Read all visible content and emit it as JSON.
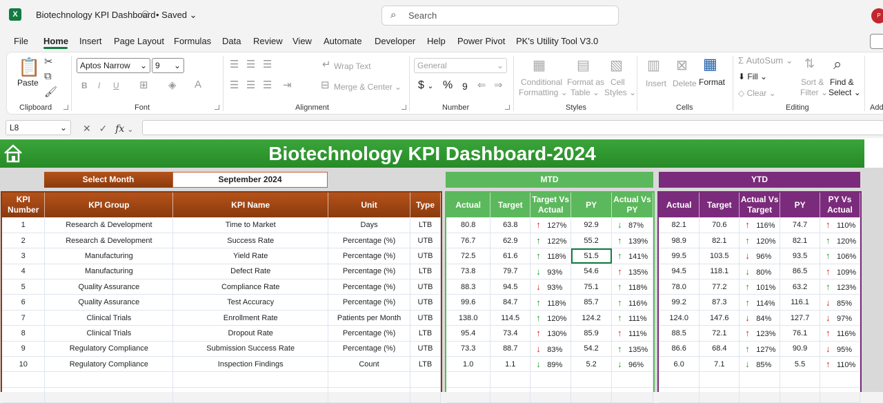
{
  "window": {
    "title": "Biotechnology KPI Dashboard",
    "saved": "• Saved",
    "search_placeholder": "Search",
    "avatar": "P"
  },
  "menu": [
    "File",
    "Home",
    "Insert",
    "Page Layout",
    "Formulas",
    "Data",
    "Review",
    "View",
    "Automate",
    "Developer",
    "Help",
    "Power Pivot",
    "PK's Utility Tool V3.0"
  ],
  "ribbon": {
    "clipboard": {
      "label": "Clipboard",
      "paste": "Paste"
    },
    "font": {
      "label": "Font",
      "name": "Aptos Narrow",
      "size": "9",
      "bold": "B",
      "italic": "I",
      "underline": "U"
    },
    "alignment": {
      "label": "Alignment",
      "wrap": "Wrap Text",
      "merge": "Merge & Center"
    },
    "number": {
      "label": "Number",
      "format": "General",
      "dollar": "$",
      "percent": "%",
      "comma": "9"
    },
    "styles": {
      "label": "Styles",
      "conditional": "Conditional",
      "conditional2": "Formatting",
      "format_table": "Format as",
      "format_table2": "Table",
      "cell_styles": "Cell",
      "cell_styles2": "Styles"
    },
    "cells": {
      "label": "Cells",
      "insert": "Insert",
      "delete": "Delete",
      "format": "Format"
    },
    "editing": {
      "label": "Editing",
      "autosum": "AutoSum",
      "fill": "Fill",
      "clear": "Clear",
      "sort": "Sort &",
      "sort2": "Filter",
      "find": "Find &",
      "find2": "Select"
    },
    "addins": {
      "label": "Add"
    }
  },
  "formula_bar": {
    "cell": "L8",
    "fx": "fx"
  },
  "dashboard": {
    "title": "Biotechnology KPI Dashboard-2024",
    "select_month_label": "Select Month",
    "select_month_value": "September 2024",
    "mtd_label": "MTD",
    "ytd_label": "YTD",
    "kpi_headers": [
      "KPI Number",
      "KPI Group",
      "KPI Name",
      "Unit",
      "Type"
    ],
    "mtd_headers": [
      "Actual",
      "Target",
      "Target Vs Actual",
      "PY",
      "Actual Vs PY"
    ],
    "ytd_headers": [
      "Actual",
      "Target",
      "Actual Vs Target",
      "PY",
      "PY Vs Actual"
    ],
    "rows": [
      {
        "num": "1",
        "group": "Research & Development",
        "name": "Time to Market",
        "unit": "Days",
        "type": "LTB",
        "mtd": [
          "80.8",
          "63.8",
          "127%",
          "92.9",
          "87%"
        ],
        "mtd_arrows": [
          "up-red",
          "down-green"
        ],
        "ytd": [
          "82.1",
          "70.6",
          "116%",
          "74.7",
          "110%"
        ],
        "ytd_arrows": [
          "up-red",
          "up-red"
        ]
      },
      {
        "num": "2",
        "group": "Research & Development",
        "name": "Success Rate",
        "unit": "Percentage (%)",
        "type": "UTB",
        "mtd": [
          "76.7",
          "62.9",
          "122%",
          "55.2",
          "139%"
        ],
        "mtd_arrows": [
          "up",
          "up"
        ],
        "ytd": [
          "98.9",
          "82.1",
          "120%",
          "82.1",
          "120%"
        ],
        "ytd_arrows": [
          "up",
          "up"
        ]
      },
      {
        "num": "3",
        "group": "Manufacturing",
        "name": "Yield Rate",
        "unit": "Percentage (%)",
        "type": "UTB",
        "mtd": [
          "72.5",
          "61.6",
          "118%",
          "51.5",
          "141%"
        ],
        "mtd_arrows": [
          "up",
          "up"
        ],
        "ytd": [
          "99.5",
          "103.5",
          "96%",
          "93.5",
          "106%"
        ],
        "ytd_arrows": [
          "down-red",
          "up"
        ]
      },
      {
        "num": "4",
        "group": "Manufacturing",
        "name": "Defect Rate",
        "unit": "Percentage (%)",
        "type": "LTB",
        "mtd": [
          "73.8",
          "79.7",
          "93%",
          "54.6",
          "135%"
        ],
        "mtd_arrows": [
          "down-green",
          "up-red"
        ],
        "ytd": [
          "94.5",
          "118.1",
          "80%",
          "86.5",
          "109%"
        ],
        "ytd_arrows": [
          "down-green",
          "up-red"
        ]
      },
      {
        "num": "5",
        "group": "Quality Assurance",
        "name": "Compliance Rate",
        "unit": "Percentage (%)",
        "type": "UTB",
        "mtd": [
          "88.3",
          "94.5",
          "93%",
          "75.1",
          "118%"
        ],
        "mtd_arrows": [
          "down-red",
          "up"
        ],
        "ytd": [
          "78.0",
          "77.2",
          "101%",
          "63.2",
          "123%"
        ],
        "ytd_arrows": [
          "up",
          "up"
        ]
      },
      {
        "num": "6",
        "group": "Quality Assurance",
        "name": "Test Accuracy",
        "unit": "Percentage (%)",
        "type": "UTB",
        "mtd": [
          "99.6",
          "84.7",
          "118%",
          "85.7",
          "116%"
        ],
        "mtd_arrows": [
          "up",
          "up"
        ],
        "ytd": [
          "99.2",
          "87.3",
          "114%",
          "116.1",
          "85%"
        ],
        "ytd_arrows": [
          "up",
          "down-red"
        ]
      },
      {
        "num": "7",
        "group": "Clinical Trials",
        "name": "Enrollment Rate",
        "unit": "Patients per Month",
        "type": "UTB",
        "mtd": [
          "138.0",
          "114.5",
          "120%",
          "124.2",
          "111%"
        ],
        "mtd_arrows": [
          "up",
          "up"
        ],
        "ytd": [
          "124.0",
          "147.6",
          "84%",
          "127.7",
          "97%"
        ],
        "ytd_arrows": [
          "down-red",
          "down-red"
        ]
      },
      {
        "num": "8",
        "group": "Clinical Trials",
        "name": "Dropout Rate",
        "unit": "Percentage (%)",
        "type": "LTB",
        "mtd": [
          "95.4",
          "73.4",
          "130%",
          "85.9",
          "111%"
        ],
        "mtd_arrows": [
          "up-red",
          "up-red"
        ],
        "ytd": [
          "88.5",
          "72.1",
          "123%",
          "76.1",
          "116%"
        ],
        "ytd_arrows": [
          "up-red",
          "up-red"
        ]
      },
      {
        "num": "9",
        "group": "Regulatory Compliance",
        "name": "Submission Success Rate",
        "unit": "Percentage (%)",
        "type": "UTB",
        "mtd": [
          "73.3",
          "88.7",
          "83%",
          "54.2",
          "135%"
        ],
        "mtd_arrows": [
          "down-red",
          "up"
        ],
        "ytd": [
          "86.6",
          "68.4",
          "127%",
          "90.9",
          "95%"
        ],
        "ytd_arrows": [
          "up",
          "down-red"
        ]
      },
      {
        "num": "10",
        "group": "Regulatory Compliance",
        "name": "Inspection Findings",
        "unit": "Count",
        "type": "LTB",
        "mtd": [
          "1.0",
          "1.1",
          "89%",
          "5.2",
          "96%"
        ],
        "mtd_arrows": [
          "down-green",
          "down-green"
        ],
        "ytd": [
          "6.0",
          "7.1",
          "85%",
          "5.5",
          "110%"
        ],
        "ytd_arrows": [
          "down-green",
          "up-red"
        ]
      }
    ]
  }
}
